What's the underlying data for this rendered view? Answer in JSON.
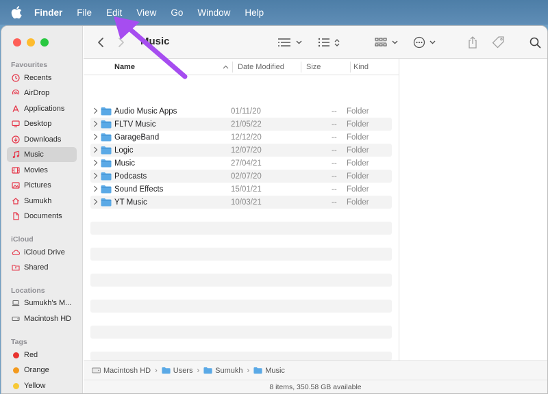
{
  "menubar": {
    "items": [
      {
        "label": "Finder",
        "bold": true
      },
      {
        "label": "File"
      },
      {
        "label": "Edit"
      },
      {
        "label": "View"
      },
      {
        "label": "Go"
      },
      {
        "label": "Window"
      },
      {
        "label": "Help"
      }
    ]
  },
  "sidebar": {
    "favourites_title": "Favourites",
    "favourites": [
      {
        "label": "Recents",
        "icon": "clock-icon",
        "color": "#e5374a"
      },
      {
        "label": "AirDrop",
        "icon": "airdrop-icon",
        "color": "#e5374a"
      },
      {
        "label": "Applications",
        "icon": "applications-icon",
        "color": "#e5374a"
      },
      {
        "label": "Desktop",
        "icon": "desktop-icon",
        "color": "#e5374a"
      },
      {
        "label": "Downloads",
        "icon": "download-icon",
        "color": "#e5374a"
      },
      {
        "label": "Music",
        "icon": "music-note-icon",
        "color": "#e5374a",
        "selected": true
      },
      {
        "label": "Movies",
        "icon": "film-icon",
        "color": "#e5374a"
      },
      {
        "label": "Pictures",
        "icon": "picture-icon",
        "color": "#e5374a"
      },
      {
        "label": "Sumukh",
        "icon": "home-icon",
        "color": "#e5374a"
      },
      {
        "label": "Documents",
        "icon": "document-icon",
        "color": "#e5374a"
      }
    ],
    "icloud_title": "iCloud",
    "icloud": [
      {
        "label": "iCloud Drive",
        "icon": "cloud-icon",
        "color": "#e5374a"
      },
      {
        "label": "Shared",
        "icon": "shared-folder-icon",
        "color": "#e5374a"
      }
    ],
    "locations_title": "Locations",
    "locations": [
      {
        "label": "Sumukh's M...",
        "icon": "laptop-icon",
        "color": "#6b6b6b"
      },
      {
        "label": "Macintosh HD",
        "icon": "disk-icon",
        "color": "#6b6b6b"
      }
    ],
    "tags_title": "Tags",
    "tags": [
      {
        "label": "Red",
        "color": "#e8332f"
      },
      {
        "label": "Orange",
        "color": "#f39a1e"
      },
      {
        "label": "Yellow",
        "color": "#f7c936"
      }
    ]
  },
  "toolbar": {
    "title": "Music"
  },
  "list": {
    "columns": {
      "name": "Name",
      "date": "Date Modified",
      "size": "Size",
      "kind": "Kind"
    },
    "rows": [
      {
        "name": "Audio Music Apps",
        "date": "01/11/20",
        "size": "--",
        "kind": "Folder"
      },
      {
        "name": "FLTV Music",
        "date": "21/05/22",
        "size": "--",
        "kind": "Folder"
      },
      {
        "name": "GarageBand",
        "date": "12/12/20",
        "size": "--",
        "kind": "Folder"
      },
      {
        "name": "Logic",
        "date": "12/07/20",
        "size": "--",
        "kind": "Folder"
      },
      {
        "name": "Music",
        "date": "27/04/21",
        "size": "--",
        "kind": "Folder"
      },
      {
        "name": "Podcasts",
        "date": "02/07/20",
        "size": "--",
        "kind": "Folder"
      },
      {
        "name": "Sound Effects",
        "date": "15/01/21",
        "size": "--",
        "kind": "Folder"
      },
      {
        "name": "YT Music",
        "date": "10/03/21",
        "size": "--",
        "kind": "Folder"
      }
    ]
  },
  "pathbar": {
    "crumbs": [
      "Macintosh HD",
      "Users",
      "Sumukh",
      "Music"
    ]
  },
  "status": {
    "text": "8 items, 350.58 GB available"
  },
  "colors": {
    "accent_arrow": "#a64df0",
    "folder": "#5aa9e6",
    "sidebar_icon": "#e5374a"
  }
}
